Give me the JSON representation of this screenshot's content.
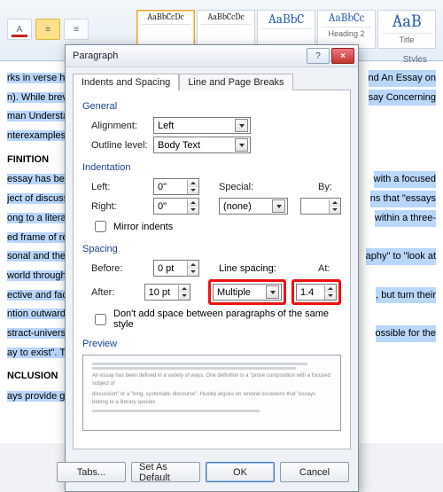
{
  "ribbon": {
    "section_label": "Styles",
    "styles": [
      {
        "preview": "AaBbCcDc",
        "caption": "",
        "size": "10px"
      },
      {
        "preview": "AaBbCcDc",
        "caption": "",
        "size": "10px"
      },
      {
        "preview": "AaBbC",
        "caption": "",
        "size": "15px"
      },
      {
        "preview": "AaBbCc",
        "caption": "Heading 2",
        "size": "13px"
      },
      {
        "preview": "AaB",
        "caption": "Title",
        "size": "20px"
      }
    ]
  },
  "dialog": {
    "title": "Paragraph",
    "tabs": {
      "indents": "Indents and Spacing",
      "breaks": "Line and Page Breaks"
    },
    "general": {
      "title": "General",
      "alignment": {
        "label": "Alignment:",
        "value": "Left"
      },
      "outline": {
        "label": "Outline level:",
        "value": "Body Text"
      }
    },
    "indent": {
      "title": "Indentation",
      "left": {
        "label": "Left:",
        "value": "0\""
      },
      "right": {
        "label": "Right:",
        "value": "0\""
      },
      "special": {
        "label": "Special:",
        "value": "(none)"
      },
      "by": {
        "label": "By:",
        "value": ""
      },
      "mirror": "Mirror indents"
    },
    "spacing": {
      "title": "Spacing",
      "before": {
        "label": "Before:",
        "value": "0 pt"
      },
      "after": {
        "label": "After:",
        "value": "10 pt"
      },
      "line": {
        "label": "Line spacing:",
        "value": "Multiple"
      },
      "at": {
        "label": "At:",
        "value": "1.4"
      },
      "noadd": "Don't add space between paragraphs of the same style"
    },
    "preview": {
      "title": "Preview"
    },
    "buttons": {
      "tabs": "Tabs...",
      "default": "Set As Default",
      "ok": "OK",
      "cancel": "Cancel"
    }
  },
  "doc": {
    "l1": "rks in verse have",
    "l1b": "nd An Essay on",
    "l2": "n). While brevity",
    "l2b": "say Concerning",
    "l3": "man Understand",
    "l4": "nterexamples.",
    "h1": "FINITION",
    "l5": "essay has been d",
    "l5b": "with a focused",
    "l6": "ject of discussio",
    "l6b": "ns that \"essays",
    "l7": "ong to a literary",
    "l7b": "within a three-",
    "l8": "ed frame of refe",
    "l9": "sonal and the au",
    "l9b": "aphy\" to \"look at",
    "l10": "world through t",
    "l11": "ective and factu",
    "l11b": ", but turn their",
    "l12": "ntion outward t",
    "l13": "stract-universal:",
    "l13b": "ossible for the",
    "l14": "ay to exist\". This",
    "h2": "NCLUSION",
    "l15": "ays provide grea"
  }
}
